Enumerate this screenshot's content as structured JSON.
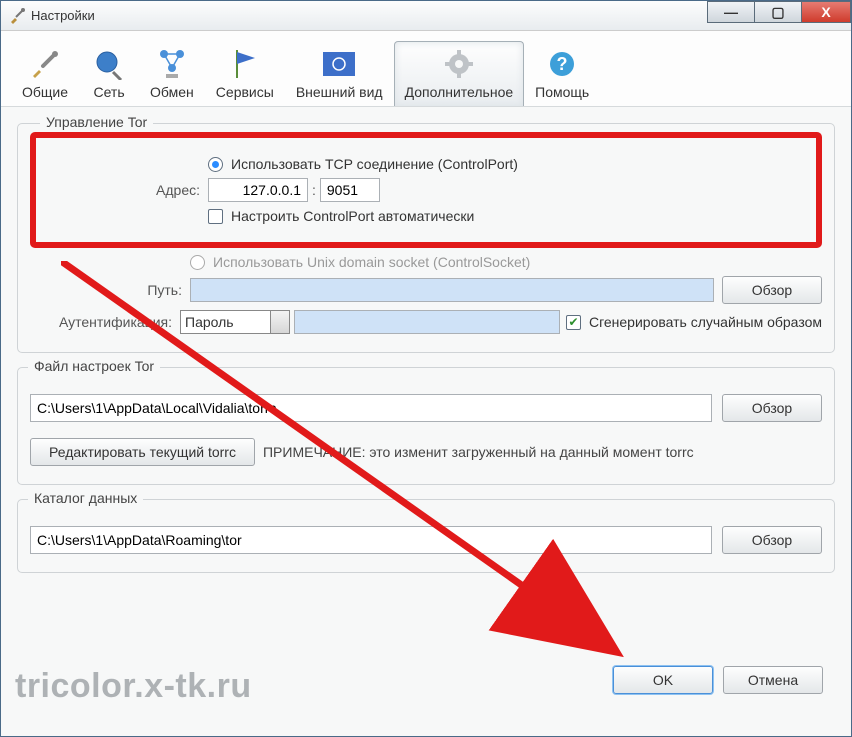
{
  "window": {
    "title": "Настройки"
  },
  "winbtns": {
    "min": "—",
    "max": "▢",
    "close": "X"
  },
  "toolbar": {
    "items": [
      {
        "label": "Общие"
      },
      {
        "label": "Сеть"
      },
      {
        "label": "Обмен"
      },
      {
        "label": "Сервисы"
      },
      {
        "label": "Внешний вид"
      },
      {
        "label": "Дополнительное"
      },
      {
        "label": "Помощь"
      }
    ]
  },
  "tor_group": {
    "title": "Управление Tor",
    "radio_tcp": "Использовать TCP соединение (ControlPort)",
    "address_label": "Адрес:",
    "address_value": "127.0.0.1",
    "port_value": "9051",
    "auto_controlport": "Настроить ControlPort автоматически",
    "radio_socket": "Использовать Unix domain socket (ControlSocket)",
    "path_label": "Путь:",
    "path_value": "",
    "browse": "Обзор",
    "auth_label": "Аутентификация:",
    "auth_select_value": "Пароль",
    "auth_random": "Сгенерировать случайным образом"
  },
  "torrc_group": {
    "title": "Файл настроек Tor",
    "path": "C:\\Users\\1\\AppData\\Local\\Vidalia\\torrc",
    "browse": "Обзор",
    "edit_button": "Редактировать текущий torrc",
    "note": "ПРИМЕЧАНИЕ: это изменит загруженный на данный момент torrc"
  },
  "data_group": {
    "title": "Каталог данных",
    "path": "C:\\Users\\1\\AppData\\Roaming\\tor",
    "browse": "Обзор"
  },
  "buttons": {
    "ok": "OK",
    "cancel": "Отмена"
  },
  "watermark": "tricolor.x-tk.ru",
  "colors": {
    "accent_red": "#e11a1a"
  }
}
